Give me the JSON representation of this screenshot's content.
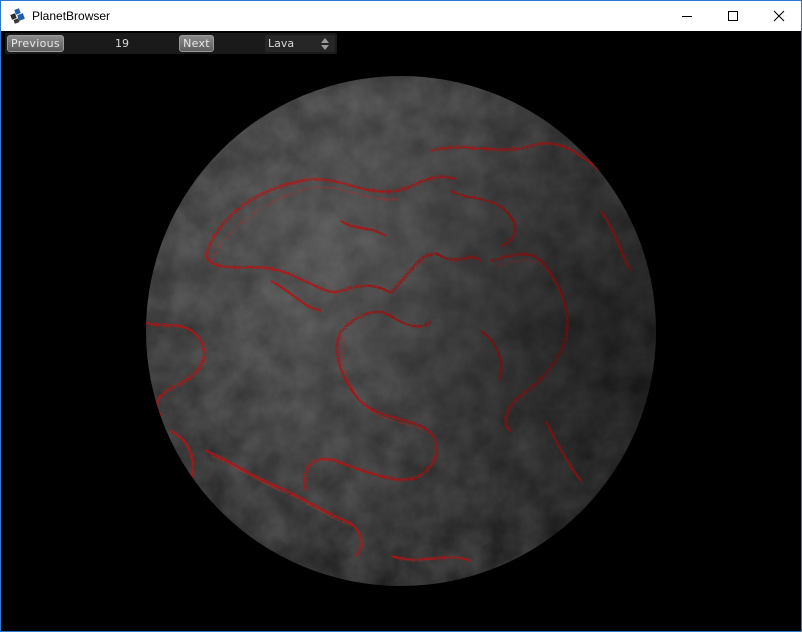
{
  "window": {
    "title": "PlanetBrowser",
    "title_color": "#000000",
    "border_color": "#2b78d4"
  },
  "icons": {
    "app": "planet-browser-app-icon",
    "minimize": "minimize-icon",
    "maximize": "maximize-icon",
    "close": "close-icon",
    "select_arrows": "up-down-arrows-icon"
  },
  "toolbar": {
    "previous_label": "Previous",
    "index_value": "19",
    "next_label": "Next",
    "planet_type": {
      "selected": "Lava"
    }
  },
  "scene": {
    "background_color": "#000000",
    "planet_color": "#3a3a3a",
    "lava_color": "#c01818"
  }
}
